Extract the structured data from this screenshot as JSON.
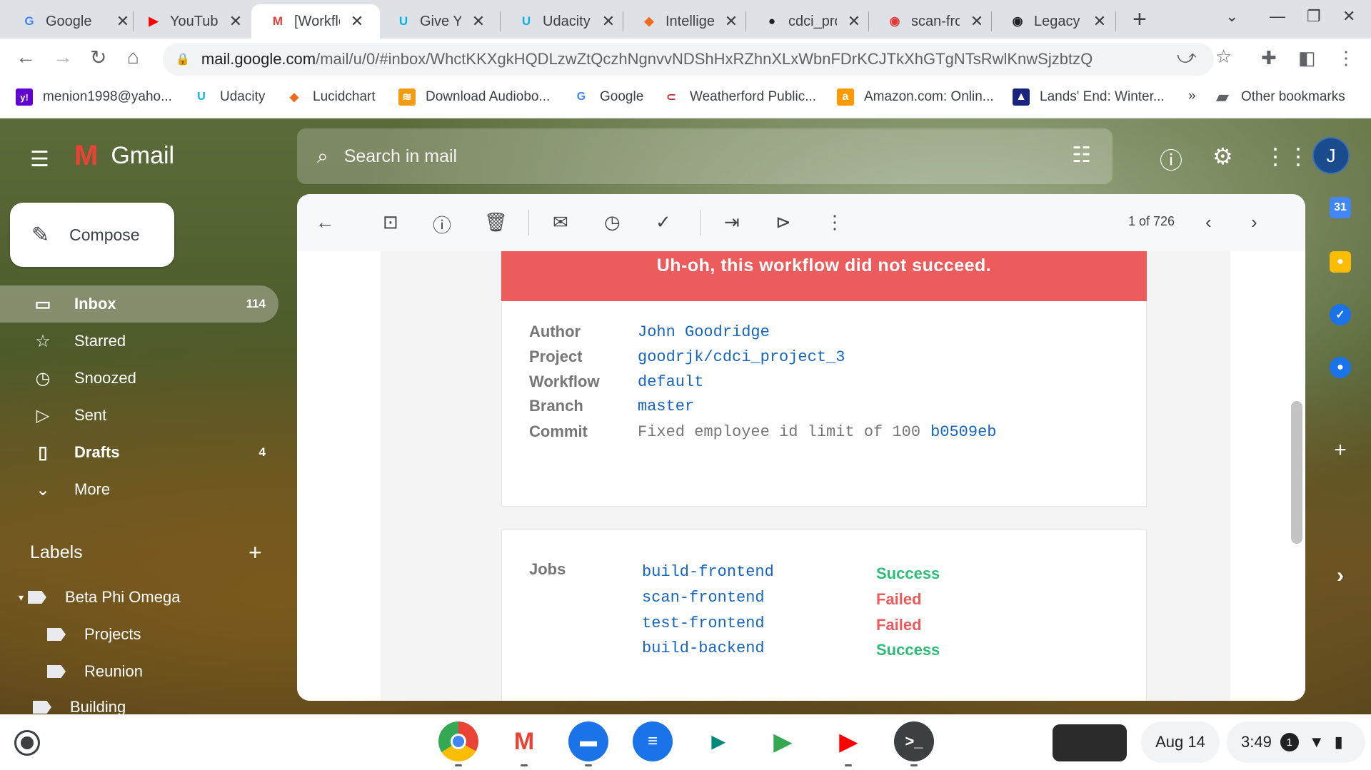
{
  "browser": {
    "tabs": [
      {
        "label": "Google",
        "favicon": "G",
        "color": "#4285f4"
      },
      {
        "label": "YouTube",
        "favicon": "▶",
        "color": "#ff0000"
      },
      {
        "label": "[Workflow",
        "favicon": "M",
        "color": "#ea4335"
      },
      {
        "label": "Give Your",
        "favicon": "U",
        "color": "#02b3e4"
      },
      {
        "label": "Udacity",
        "favicon": "U",
        "color": "#02b3e4"
      },
      {
        "label": "Intelligent",
        "favicon": "◆",
        "color": "#f26b1d"
      },
      {
        "label": "cdci_project",
        "favicon": "●",
        "color": "#202124"
      },
      {
        "label": "scan-frontend",
        "favicon": "◉",
        "color": "#e53935"
      },
      {
        "label": "Legacy",
        "favicon": "◉",
        "color": "#202124"
      }
    ],
    "url_host": "mail.google.com",
    "url_path": "/mail/u/0/#inbox/WhctKKXgkHQDLzwZtQczhNgnvvNDShHxRZhnXLxWbnFDrKCJTkXhGTgNTsRwlKnwSjzbtzQ",
    "bookmarks": [
      {
        "label": "menion1998@yaho...",
        "icon": "y!",
        "color": "#6001d2"
      },
      {
        "label": "Udacity",
        "icon": "U",
        "color": "#02b3e4"
      },
      {
        "label": "Lucidchart",
        "icon": "◆",
        "color": "#f26b1d"
      },
      {
        "label": "Download Audiobo...",
        "icon": "≋",
        "color": "#f39c12"
      },
      {
        "label": "Google",
        "icon": "G",
        "color": "#4285f4"
      },
      {
        "label": "Weatherford Public...",
        "icon": "⊂",
        "color": "#c62828"
      },
      {
        "label": "Amazon.com: Onlin...",
        "icon": "a",
        "color": "#ff9900"
      },
      {
        "label": "Lands' End: Winter...",
        "icon": "▲",
        "color": "#1a237e"
      }
    ],
    "more_bookmarks": "»",
    "other_bookmarks": "Other bookmarks"
  },
  "gmail": {
    "brand": "Gmail",
    "search_placeholder": "Search in mail",
    "avatar_initial": "J",
    "compose_label": "Compose",
    "nav": [
      {
        "label": "Inbox",
        "count": "114",
        "icon": "inbox-icon",
        "glyph": "▭"
      },
      {
        "label": "Starred",
        "count": "",
        "icon": "star-icon",
        "glyph": "☆"
      },
      {
        "label": "Snoozed",
        "count": "",
        "icon": "clock-icon",
        "glyph": "◷"
      },
      {
        "label": "Sent",
        "count": "",
        "icon": "send-icon",
        "glyph": "▷"
      },
      {
        "label": "Drafts",
        "count": "4",
        "icon": "draft-icon",
        "glyph": "▯"
      },
      {
        "label": "More",
        "count": "",
        "icon": "chevron-down-icon",
        "glyph": "⌄"
      }
    ],
    "labels_header": "Labels",
    "labels": [
      {
        "label": "Beta Phi Omega"
      },
      {
        "label": "Projects"
      },
      {
        "label": "Reunion"
      },
      {
        "label": "Building"
      }
    ],
    "pager": "1 of 726"
  },
  "email": {
    "banner": "Uh-oh, this workflow did not succeed.",
    "details": {
      "author_label": "Author",
      "author": "John Goodridge",
      "project_label": "Project",
      "project": "goodrjk/cdci_project_3",
      "workflow_label": "Workflow",
      "workflow": "default",
      "branch_label": "Branch",
      "branch": "master",
      "commit_label": "Commit",
      "commit_msg": "Fixed employee id limit of 100",
      "commit_hash": "b0509eb"
    },
    "jobs_label": "Jobs",
    "jobs": [
      {
        "name": "build-frontend",
        "status": "Success"
      },
      {
        "name": "scan-frontend",
        "status": "Failed"
      },
      {
        "name": "test-frontend",
        "status": "Failed"
      },
      {
        "name": "build-backend",
        "status": "Success"
      }
    ]
  },
  "shelf": {
    "date": "Aug 14",
    "time": "3:49",
    "notifications": "1"
  }
}
